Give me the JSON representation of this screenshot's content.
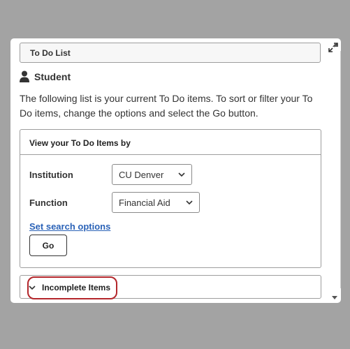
{
  "todo": {
    "title": "To Do List",
    "role": "Student",
    "description": "The following list is your current To Do items. To sort or filter your To Do items, change the options and select the Go button."
  },
  "view": {
    "header": "View your To Do Items by",
    "institution_label": "Institution",
    "institution_value": "CU Denver",
    "function_label": "Function",
    "function_value": "Financial Aid",
    "search_link": "Set search options",
    "go_label": "Go"
  },
  "incomplete": {
    "label": "Incomplete Items"
  },
  "icons": {
    "expand": "expand-icon",
    "person": "person-icon",
    "chevron": "chevron-down-icon"
  },
  "colors": {
    "highlight": "#b3262b",
    "link": "#2a62b7",
    "backdrop": "#a3a3a3"
  }
}
